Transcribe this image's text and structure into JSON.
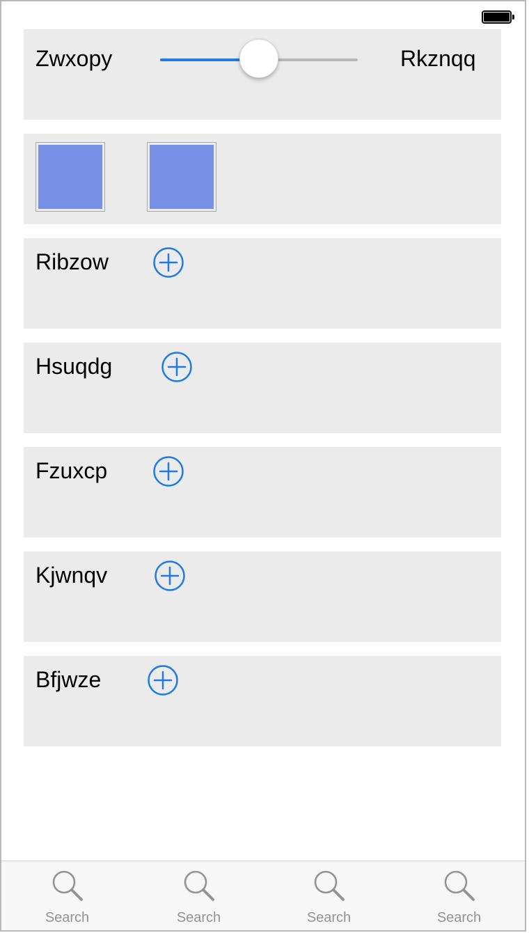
{
  "slider": {
    "min_label": "Zwxopy",
    "max_label": "Rkznqq",
    "value_fraction": 0.5,
    "min_track_color": "#1f7ae6",
    "max_track_color": "#b7b7b7"
  },
  "swatches": [
    {
      "color": "#7890e6"
    },
    {
      "color": "#7890e6"
    }
  ],
  "rows": [
    {
      "label": "Ribzow",
      "icon": "add-circle-icon"
    },
    {
      "label": "Hsuqdg",
      "icon": "add-circle-icon"
    },
    {
      "label": "Fzuxcp",
      "icon": "add-circle-icon"
    },
    {
      "label": "Kjwnqv",
      "icon": "add-circle-icon"
    },
    {
      "label": "Bfjwze",
      "icon": "add-circle-icon"
    }
  ],
  "accent_color": "#1f7ae6",
  "tabs": [
    {
      "label": "Search",
      "icon": "search-icon"
    },
    {
      "label": "Search",
      "icon": "search-icon"
    },
    {
      "label": "Search",
      "icon": "search-icon"
    },
    {
      "label": "Search",
      "icon": "search-icon"
    }
  ]
}
